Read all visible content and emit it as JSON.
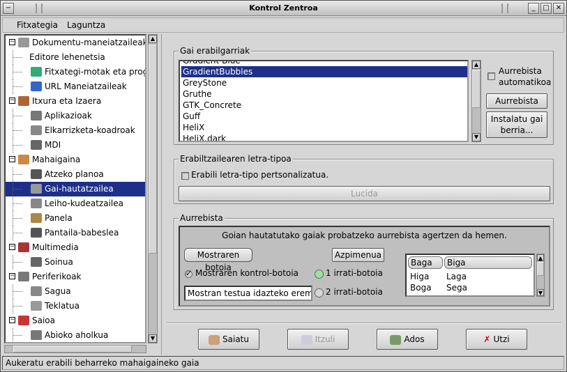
{
  "window": {
    "title": "Kontrol Zentroa"
  },
  "menu": [
    {
      "label": "Fitxategia"
    },
    {
      "label": "Laguntza"
    }
  ],
  "tree": [
    {
      "label": "Dokumentu-maneiatzaileak",
      "level": 0,
      "expander": "−",
      "icon": "documents-icon",
      "color": ""
    },
    {
      "label": "Editore lehenetsia",
      "level": 1,
      "icon": "",
      "color": ""
    },
    {
      "label": "Fitxategi-motak eta progra",
      "level": 1,
      "icon": "file-types-icon",
      "color": "#3a7"
    },
    {
      "label": "URL Maneiatzaileak",
      "level": 1,
      "icon": "globe-icon",
      "color": "#36c"
    },
    {
      "label": "Itxura eta Izaera",
      "level": 0,
      "expander": "−",
      "icon": "appearance-icon",
      "color": "#a63"
    },
    {
      "label": "Aplikazioak",
      "level": 1,
      "icon": "applications-icon",
      "color": "#777"
    },
    {
      "label": "Elkarrizketa-koadroak",
      "level": 1,
      "icon": "dialogs-icon",
      "color": "#888"
    },
    {
      "label": "MDI",
      "level": 1,
      "icon": "mdi-icon",
      "color": "#666"
    },
    {
      "label": "Mahaigaina",
      "level": 0,
      "expander": "−",
      "icon": "desktop-icon",
      "color": "#c84"
    },
    {
      "label": "Atzeko planoa",
      "level": 1,
      "icon": "background-icon",
      "color": "#555"
    },
    {
      "label": "Gai-hautatzailea",
      "level": 1,
      "icon": "theme-selector-icon",
      "color": "#999",
      "selected": true
    },
    {
      "label": "Leiho-kudeatzailea",
      "level": 1,
      "icon": "window-manager-icon",
      "color": "#888"
    },
    {
      "label": "Panela",
      "level": 1,
      "icon": "panel-icon",
      "color": "#a84"
    },
    {
      "label": "Pantaila-babeslea",
      "level": 1,
      "icon": "screensaver-icon",
      "color": "#555"
    },
    {
      "label": "Multimedia",
      "level": 0,
      "expander": "−",
      "icon": "multimedia-icon",
      "color": "#a33"
    },
    {
      "label": "Soinua",
      "level": 1,
      "icon": "sound-icon",
      "color": "#666"
    },
    {
      "label": "Periferikoak",
      "level": 0,
      "expander": "−",
      "icon": "peripherals-icon",
      "color": "#777"
    },
    {
      "label": "Sagua",
      "level": 1,
      "icon": "mouse-icon",
      "color": "#888"
    },
    {
      "label": "Teklatua",
      "level": 1,
      "icon": "keyboard-icon",
      "color": "#999"
    },
    {
      "label": "Saioa",
      "level": 0,
      "expander": "−",
      "icon": "session-icon",
      "color": "#c33"
    },
    {
      "label": "Abioko aholkua",
      "level": 1,
      "icon": "startup-hint-icon",
      "color": "#777"
    }
  ],
  "themes": {
    "frame_label": "Gai erabilgarriak",
    "items": [
      "Gradient-Blue",
      "GradientBubbles",
      "GreyStone",
      "Gruthe",
      "GTK_Concrete",
      "Guff",
      "HeliX",
      "HeliX.dark"
    ],
    "selected_index": 1,
    "auto_preview_label": "Aurrebista automatikoa",
    "preview_button": "Aurrebista",
    "install_button": "Instalatu gai berria..."
  },
  "font": {
    "frame_label": "Erabiltzailearen letra-tipoa",
    "custom_font_label": "Erabili letra-tipo pertsonalizatua.",
    "font_button": "Lucida"
  },
  "preview": {
    "frame_label": "Aurrebista",
    "description": "Goian hautatutako gaiak probatzeko aurrebista agertzen da hemen.",
    "sample_button": "Mostraren botoia",
    "submenu_button": "Azpimenua",
    "check_label": "Mostraren kontrol-botoia",
    "radio1_label": "1 irrati-botoia",
    "radio2_label": "2 irrati-botoia",
    "entry_text": "Mostran testua idazteko eremua",
    "clist": {
      "headers": [
        "Baga",
        "Biga"
      ],
      "rows": [
        [
          "Higa",
          "Laga"
        ],
        [
          "Boga",
          "Sega"
        ]
      ]
    }
  },
  "actions": {
    "save": "Saiatu",
    "revert": "Itzuli",
    "ok": "Ados",
    "cancel": "Utzi"
  },
  "status": "Aukeratu erabili beharreko mahaigaineko gaia"
}
